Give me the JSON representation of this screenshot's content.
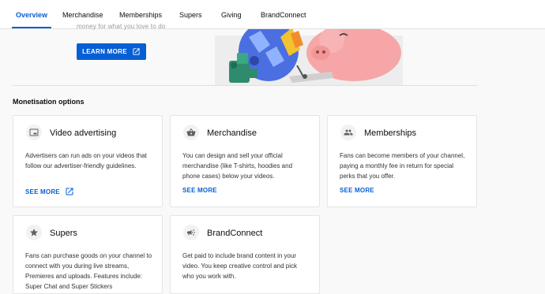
{
  "tabs": [
    {
      "label": "Overview",
      "active": true
    },
    {
      "label": "Merchandise"
    },
    {
      "label": "Memberships"
    },
    {
      "label": "Supers"
    },
    {
      "label": "Giving"
    },
    {
      "label": "BrandConnect"
    }
  ],
  "hero": {
    "partial_text": "money for what you love to do",
    "learn_more": "LEARN MORE"
  },
  "section_title": "Monetisation options",
  "cards": [
    {
      "icon": "video-ad-icon",
      "title": "Video advertising",
      "desc": "Advertisers can run ads on your videos that follow our advertiser-friendly guidelines.",
      "link": "SEE MORE",
      "external": true
    },
    {
      "icon": "shopping-basket-icon",
      "title": "Merchandise",
      "desc": "You can design and sell your official merchandise (like T-shirts, hoodies and phone cases) below your videos.",
      "link": "SEE MORE"
    },
    {
      "icon": "people-icon",
      "title": "Memberships",
      "desc": "Fans can become members of your channel, paying a monthly fee in return for special perks that you offer.",
      "link": "SEE MORE"
    },
    {
      "icon": "star-icon",
      "title": "Supers",
      "desc": "Fans can purchase goods on your channel to connect with you during live streams, Premieres and uploads. Features include: Super Chat and Super Stickers"
    },
    {
      "icon": "megaphone-icon",
      "title": "BrandConnect",
      "desc": "Get paid to include brand content in your video. You keep creative control and pick who you work with."
    }
  ],
  "colors": {
    "accent": "#065fd4",
    "background": "#f9f9f9"
  }
}
